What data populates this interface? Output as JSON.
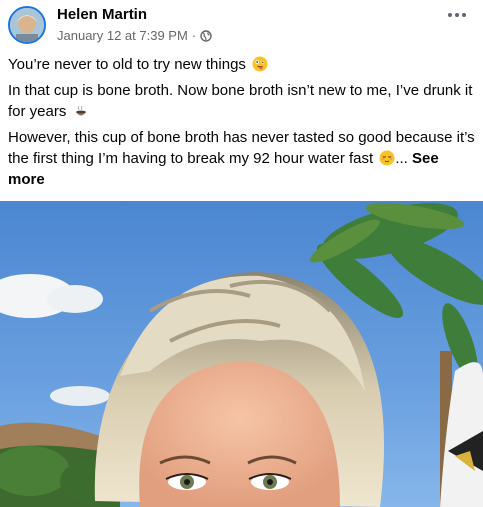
{
  "post": {
    "author": "Helen Martin",
    "timestamp": "January 12 at 7:39 PM",
    "separator": "·",
    "privacy_icon": "globe-icon",
    "menu_icon": "more-options-icon",
    "paragraphs": {
      "p1": "You’re never to old to try new things",
      "p1_emoji": "silly-face-emoji",
      "p2": "In that cup is bone broth. Now bone broth isn’t new to me, I’ve drunk it for years",
      "p2_emoji": "hot-beverage-emoji",
      "p3": "However, this cup of bone broth has never tasted so good because it’s the first thing I’m having to break my 92 hour water fast",
      "p3_emoji": "relieved-face-emoji",
      "ellipsis": "...",
      "see_more": "See more"
    }
  },
  "colors": {
    "name": "#050505",
    "meta": "#65676b",
    "avatar_ring": "#1b74e4"
  }
}
